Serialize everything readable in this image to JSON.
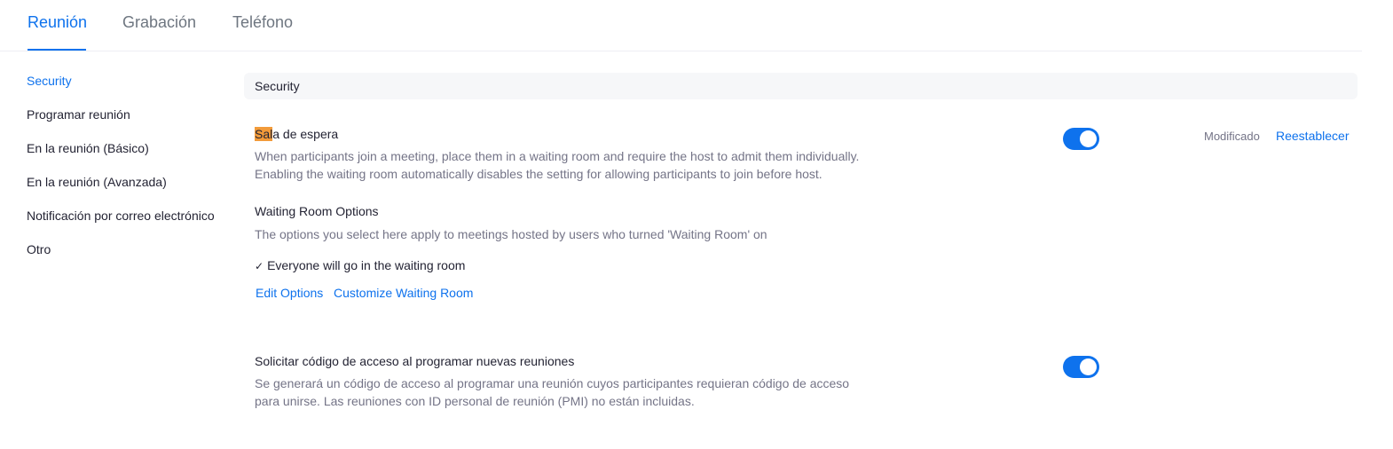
{
  "tabs": [
    {
      "label": "Reunión",
      "active": true
    },
    {
      "label": "Grabación",
      "active": false
    },
    {
      "label": "Teléfono",
      "active": false
    }
  ],
  "sidebar": {
    "items": [
      {
        "label": "Security",
        "active": true
      },
      {
        "label": "Programar reunión",
        "active": false
      },
      {
        "label": "En la reunión (Básico)",
        "active": false
      },
      {
        "label": "En la reunión (Avanzada)",
        "active": false
      },
      {
        "label": "Notificación por correo electrónico",
        "active": false
      },
      {
        "label": "Otro",
        "active": false
      }
    ]
  },
  "section": {
    "title": "Security"
  },
  "waiting_room": {
    "title_highlight": "Sal",
    "title_rest": "a de espera",
    "description": "When participants join a meeting, place them in a waiting room and require the host to admit them individually. Enabling the waiting room automatically disables the setting for allowing participants to join before host.",
    "enabled": true,
    "status": "Modificado",
    "reset_label": "Reestablecer",
    "options_title": "Waiting Room Options",
    "options_description": "The options you select here apply to meetings hosted by users who turned 'Waiting Room' on",
    "selected_option": "Everyone will go in the waiting room",
    "edit_options_label": "Edit Options",
    "customize_label": "Customize Waiting Room"
  },
  "passcode": {
    "title": "Solicitar código de acceso al programar nuevas reuniones",
    "description": "Se generará un código de acceso al programar una reunión cuyos participantes requieran código de acceso para unirse. Las reuniones con ID personal de reunión (PMI) no están incluidas.",
    "enabled": true
  },
  "colors": {
    "accent": "#0e72ed",
    "highlight": "#f29b3a"
  }
}
